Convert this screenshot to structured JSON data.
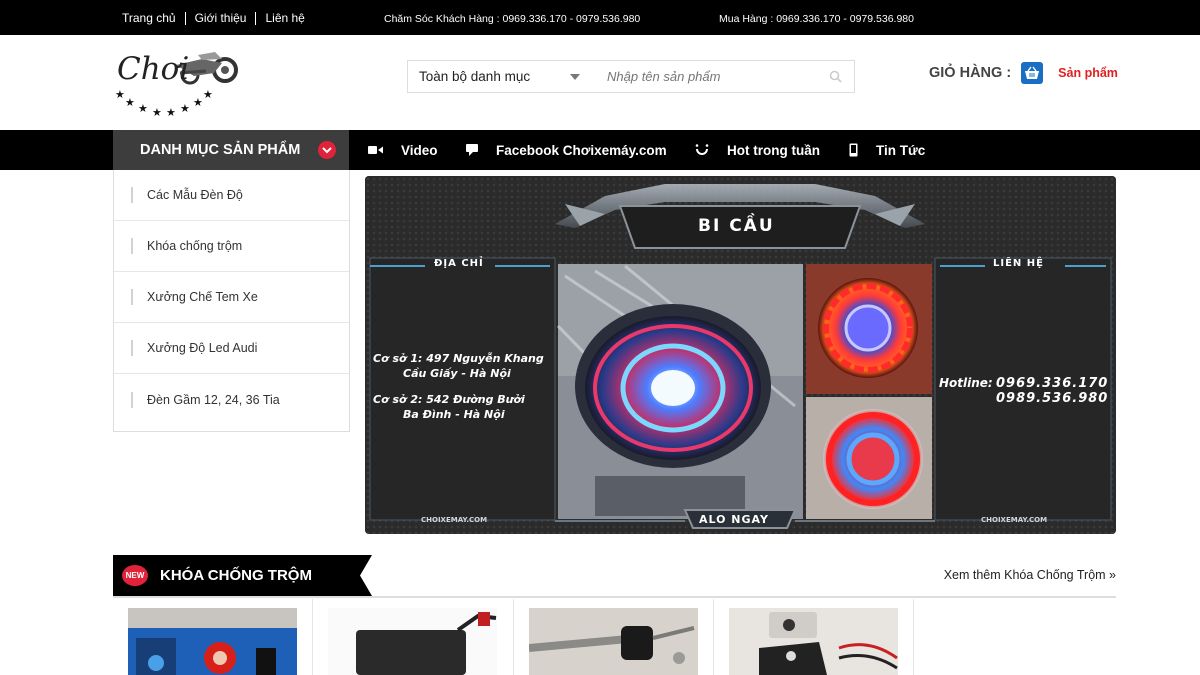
{
  "topbar": {
    "nav": [
      "Trang chủ",
      "Giới thiệu",
      "Liên hệ"
    ],
    "customer_care": "Chăm Sóc Khách Hàng : 0969.336.170 - 0979.536.980",
    "purchase": "Mua Hàng : 0969.336.170 - 0979.536.980"
  },
  "header": {
    "logo_text": "Chơi",
    "category_select": "Toàn bộ danh mục",
    "search_placeholder": "Nhập tên sản phẩm",
    "cart_label": "GIỎ HÀNG :",
    "cart_products": "Sản phẩm"
  },
  "menu": {
    "category_button": "DANH MỤC SẢN PHẨM",
    "items": [
      {
        "label": "Video",
        "icon": "video-icon"
      },
      {
        "label": "Facebook Chơixemáy.com",
        "icon": "comment-icon"
      },
      {
        "label": "Hot trong tuần",
        "icon": "spinner-icon"
      },
      {
        "label": "Tin Tức",
        "icon": "mobile-icon"
      }
    ]
  },
  "sidebar": {
    "items": [
      "Các Mẫu Đèn Độ",
      "Khóa chống trộm",
      "Xưởng Chế Tem Xe",
      "Xưởng Độ Led Audi",
      "Đèn Gầm 12, 24, 36 Tia"
    ]
  },
  "banner": {
    "title": "BI CẦU",
    "address_label": "ĐỊA CHỈ",
    "contact_label": "LIÊN HỆ",
    "address1_line1": "Cơ sở 1:  497 Nguyễn Khang",
    "address1_line2": "Cầu Giấy - Hà Nội",
    "address2_line1": "Cơ sở 2:  542 Đường Bưởi",
    "address2_line2": "Ba Đình - Hà Nội",
    "hotline_label": "Hotline:",
    "hotline1": "0969.336.170",
    "hotline2": "0989.536.980",
    "footer_left": "CHOIXEMAY.COM",
    "footer_center": "ALO NGAY",
    "footer_right": "CHOIXEMAY.COM"
  },
  "section": {
    "badge": "NEW",
    "title": "KHÓA CHỐNG TRỘM",
    "more_link": "Xem thêm Khóa Chống Trộm »"
  },
  "colors": {
    "accent_red": "#e0233b",
    "cart_blue": "#1a6fc4",
    "topbar_bg": "#000000",
    "menu_button_bg": "#3d3d3d"
  }
}
